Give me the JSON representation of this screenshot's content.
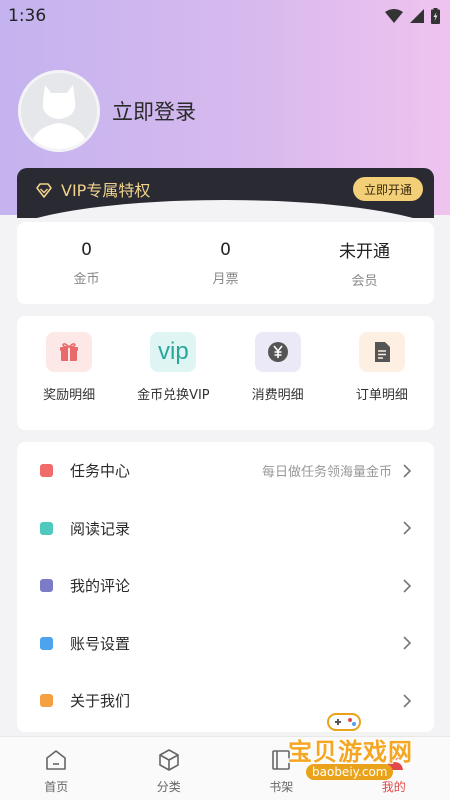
{
  "status_bar": {
    "time": "1:36"
  },
  "profile": {
    "login_label": "立即登录"
  },
  "vip_banner": {
    "title": "VIP专属特权",
    "button_label": "立即开通"
  },
  "stats": [
    {
      "value": "0",
      "label": "金币"
    },
    {
      "value": "0",
      "label": "月票"
    },
    {
      "value": "未开通",
      "label": "会员"
    }
  ],
  "shortcuts": [
    {
      "label": "奖励明细",
      "icon": "gift-icon",
      "bg": "#fde8e8",
      "fg": "#e86a6a"
    },
    {
      "label": "金币兑换VIP",
      "icon": "vip-icon",
      "bg": "#dff5f3",
      "fg": "#2aa79b",
      "icon_text": "vip"
    },
    {
      "label": "消费明细",
      "icon": "yen-icon",
      "bg": "#ebe8f8",
      "fg": "#555"
    },
    {
      "label": "订单明细",
      "icon": "document-icon",
      "bg": "#fdf0e3",
      "fg": "#555"
    }
  ],
  "menu": [
    {
      "label": "任务中心",
      "sub": "每日做任务领海量金币",
      "color": "#f16b6b"
    },
    {
      "label": "阅读记录",
      "sub": "",
      "color": "#4fc9bd"
    },
    {
      "label": "我的评论",
      "sub": "",
      "color": "#7b7bc8"
    },
    {
      "label": "账号设置",
      "sub": "",
      "color": "#4ea3ef"
    },
    {
      "label": "关于我们",
      "sub": "",
      "color": "#f5a142"
    }
  ],
  "tabs": [
    {
      "label": "首页",
      "icon": "home-icon"
    },
    {
      "label": "分类",
      "icon": "category-icon"
    },
    {
      "label": "书架",
      "icon": "bookshelf-icon"
    },
    {
      "label": "我的",
      "icon": "profile-icon",
      "active": true
    }
  ],
  "watermark": {
    "text": "宝贝游戏网",
    "url": "baobeiy.com"
  }
}
